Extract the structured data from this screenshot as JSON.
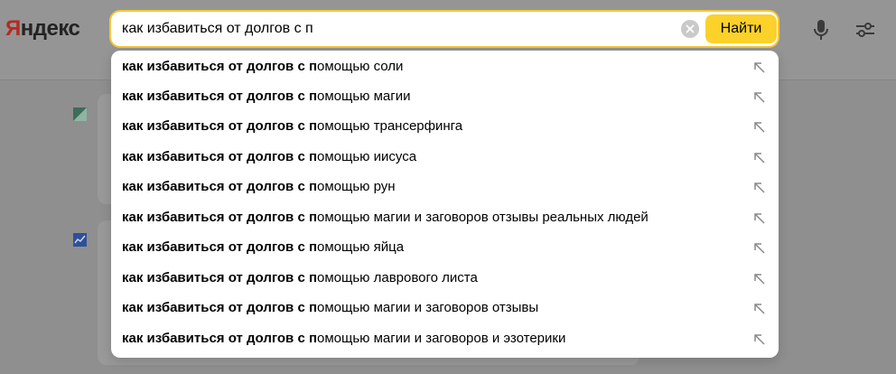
{
  "header": {
    "logo_first": "Я",
    "logo_rest": "ндекс",
    "search_value": "как избавиться от долгов с п",
    "find_label": "Найти"
  },
  "suggestions": {
    "typed_prefix": "как избавиться от долгов с п",
    "items": [
      {
        "bold": "как избавиться от долгов с п",
        "rest": "омощью соли"
      },
      {
        "bold": "как избавиться от долгов с п",
        "rest": "омощью магии"
      },
      {
        "bold": "как избавиться от долгов с п",
        "rest": "омощью трансерфинга"
      },
      {
        "bold": "как избавиться от долгов с п",
        "rest": "омощью иисуса"
      },
      {
        "bold": "как избавиться от долгов с п",
        "rest": "омощью рун"
      },
      {
        "bold": "как избавиться от долгов с п",
        "rest": "омощью магии и заговоров отзывы реальных людей"
      },
      {
        "bold": "как избавиться от долгов с п",
        "rest": "омощью яйца"
      },
      {
        "bold": "как избавиться от долгов с п",
        "rest": "омощью лаврового листа"
      },
      {
        "bold": "как избавиться от долгов с п",
        "rest": "омощью магии и заговоров отзывы"
      },
      {
        "bold": "как избавиться от долгов с п",
        "rest": "омощью магии и заговоров и эзотерики"
      }
    ],
    "item_icon": "arrow-up-left-icon"
  },
  "colors": {
    "accent": "#fbd12a",
    "logo_red": "#b32b22",
    "overlay_gray": "#8f8f8f"
  }
}
